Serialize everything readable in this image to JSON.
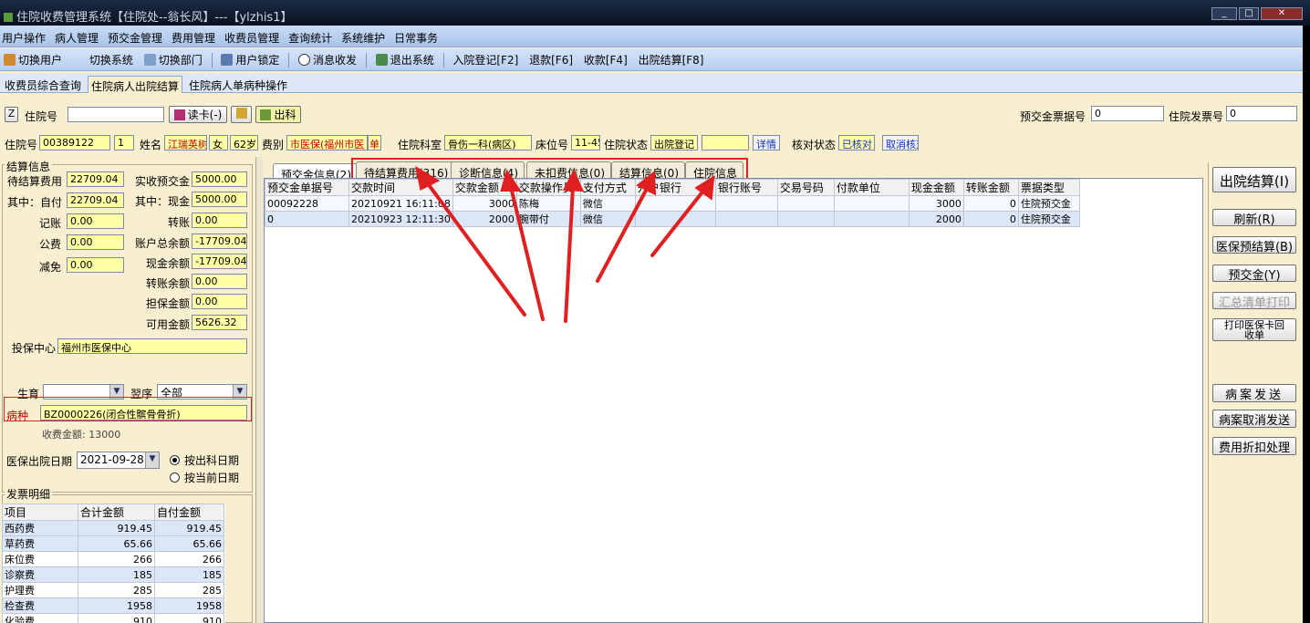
{
  "title": "住院收费管理系统【住院处--翁长风】---【ylzhis1】",
  "menu": [
    "用户操作",
    "病人管理",
    "预交金管理",
    "费用管理",
    "收费员管理",
    "查询统计",
    "系统维护",
    "日常事务"
  ],
  "toolbar": [
    "切换用户",
    "切换系统",
    "切换部门",
    "用户锁定",
    "消息收发",
    "退出系统",
    "入院登记[F2]",
    "退款[F6]",
    "收款[F4]",
    "出院结算[F8]"
  ],
  "main_tabs": [
    "收费员综合查询",
    "住院病人出院结算",
    "住院病人单病种操作"
  ],
  "top": {
    "zhuyuanhao_label": "住院号",
    "zhuyuanhao_value": "",
    "read_card": "读卡(-)",
    "out_btn": "出科",
    "z_key": "Z",
    "yujiaojin_piaoju_label": "预交金票据号",
    "yujiaojin_piaoju_value": "0",
    "fapiao_label": "住院发票号",
    "fapiao_value": "0"
  },
  "patient": {
    "zyh_label": "住院号",
    "zyh": "00389122",
    "times": "1",
    "name_label": "姓名",
    "name": "江瑞英树",
    "sex": "女",
    "age": "62岁",
    "feibie_label": "费别",
    "feibie": "市医保(福州市医",
    "single": "单",
    "keshi_label": "住院科室",
    "keshi": "骨伤一科(病区)",
    "bed_label": "床位号",
    "bed": "11-45",
    "status_label": "住院状态",
    "status": "出院登记",
    "status_extra": "",
    "detail": "详情",
    "check_label": "核对状态",
    "check": "已核对",
    "cancel_check": "取消核对"
  },
  "settle": {
    "header": "结算信息",
    "left": [
      {
        "label": "待结算费用",
        "value": "22709.04"
      },
      {
        "label": "其中：自付",
        "value": "22709.04"
      },
      {
        "label": "记账",
        "value": "0.00"
      },
      {
        "label": "公费",
        "value": "0.00"
      },
      {
        "label": "减免",
        "value": "0.00"
      }
    ],
    "right": [
      {
        "label": "实收预交金",
        "value": "5000.00"
      },
      {
        "label": "其中：现金",
        "value": "5000.00"
      },
      {
        "label": "转账",
        "value": "0.00"
      },
      {
        "label": "账户总余额",
        "value": "-17709.04"
      },
      {
        "label": "现金余额",
        "value": "-17709.04"
      },
      {
        "label": "转账余额",
        "value": "0.00"
      },
      {
        "label": "担保金额",
        "value": "0.00"
      },
      {
        "label": "可用金额",
        "value": "5626.32"
      }
    ],
    "insure_label": "投保中心",
    "insure": "福州市医保中心",
    "shengyu_label": "生育",
    "shengyu": "",
    "sort_label": "翌序",
    "sort": "全部",
    "bingzhong_label": "病种",
    "bingzhong": "BZ0000226(闭合性髌骨骨折)",
    "shoufei": "收费金额: 13000",
    "date_label": "医保出院日期",
    "date": "2021-09-28",
    "radio1": "按出科日期",
    "radio2": "按当前日期"
  },
  "invoice": {
    "header": "发票明细",
    "columns": [
      "项目",
      "合计金额",
      "自付金额"
    ],
    "rows": [
      [
        "西药费",
        "919.45",
        "919.45"
      ],
      [
        "草药费",
        "65.66",
        "65.66"
      ],
      [
        "床位费",
        "266",
        "266"
      ],
      [
        "诊察费",
        "185",
        "185"
      ],
      [
        "护理费",
        "285",
        "285"
      ],
      [
        "检查费",
        "1958",
        "1958"
      ],
      [
        "化验费",
        "910",
        "910"
      ]
    ]
  },
  "subtabs": [
    "预交金信息(2)",
    "待结算费用(316)",
    "诊断信息(4)",
    "未扣费信息(0)",
    "结算信息(0)",
    "住院信息"
  ],
  "grid": {
    "columns": [
      "预交金单据号",
      "交款时间",
      "交款金额",
      "交款操作员",
      "支付方式",
      "开户银行",
      "银行账号",
      "交易号码",
      "付款单位",
      "现金金额",
      "转账金额",
      "票据类型"
    ],
    "rows": [
      [
        "00092228",
        "20210921 16:11:08",
        "3000",
        "陈梅",
        "微信",
        "",
        "",
        "",
        "",
        "3000",
        "0",
        "住院预交金"
      ],
      [
        "0",
        "20210923 12:11:30",
        "2000",
        "腕带付",
        "微信",
        "",
        "",
        "",
        "",
        "2000",
        "0",
        "住院预交金"
      ]
    ]
  },
  "buttons": [
    "出院结算(I)",
    "刷新(R)",
    "医保预结算(B)",
    "预交金(Y)",
    "汇总清单打印",
    "打印医保卡回收单",
    "病案发送",
    "病案取消发送",
    "费用折扣处理"
  ],
  "colors": {
    "annotation": "#e02020",
    "panel": "#f7efd0",
    "input_yellow": "#ffffa8"
  }
}
